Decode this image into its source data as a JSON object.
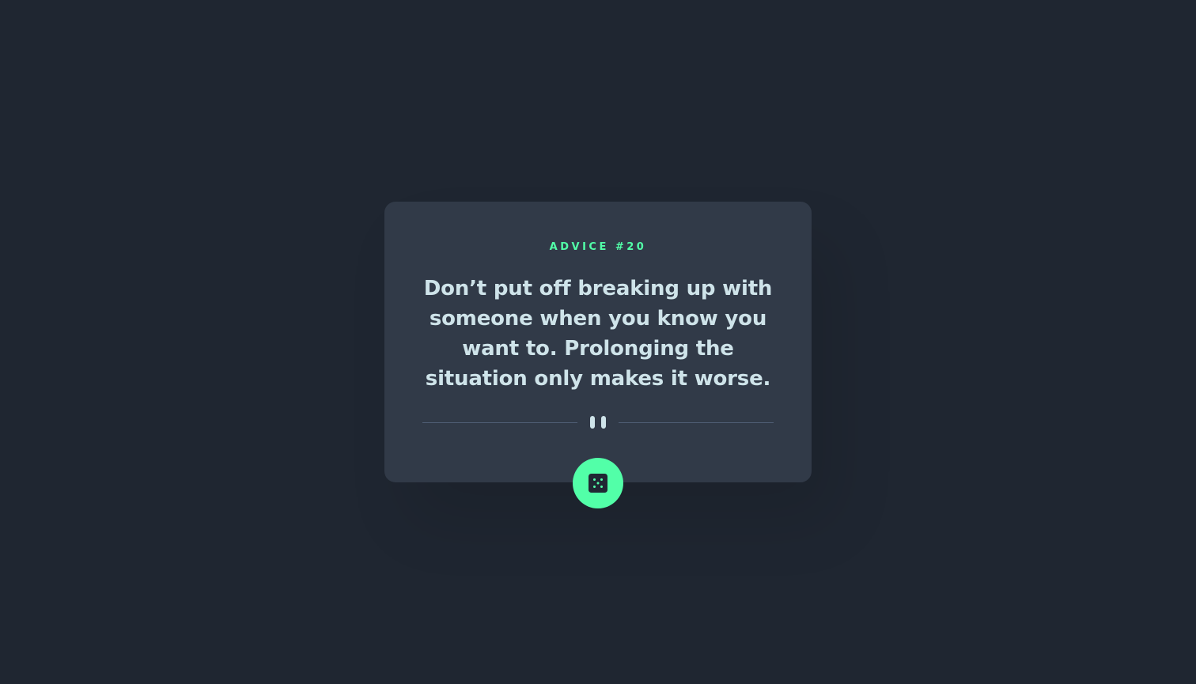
{
  "advice": {
    "label": "ADVICE #20",
    "text": "Don’t put off breaking up with someone when you know you want to. Prolonging the situation only makes it worse."
  },
  "icons": {
    "divider": "pause-icon",
    "button": "dice-icon"
  },
  "colors": {
    "background": "#1f2631",
    "card": "#313a48",
    "accent": "#52ffa8",
    "text": "#cee3e9",
    "divider": "#4f5d74"
  }
}
